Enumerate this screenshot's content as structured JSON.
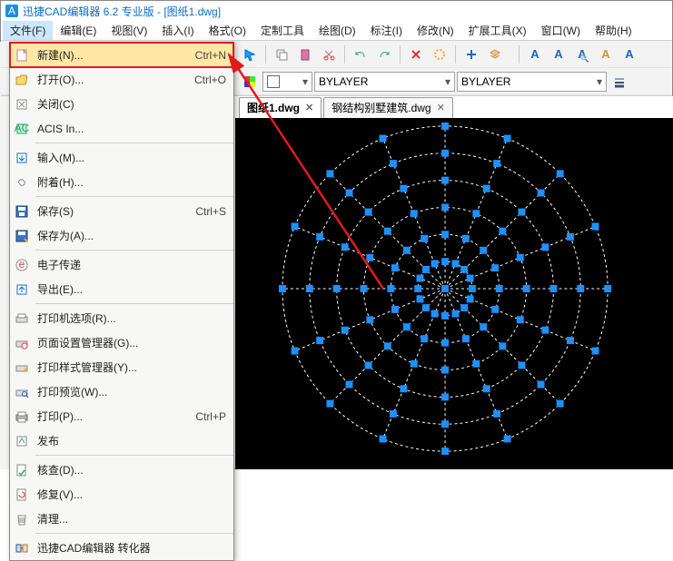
{
  "title": "迅捷CAD编辑器 6.2 专业版  -  [图纸1.dwg]",
  "menubar": [
    "文件(F)",
    "编辑(E)",
    "视图(V)",
    "插入(I)",
    "格式(O)",
    "定制工具",
    "绘图(D)",
    "标注(I)",
    "修改(N)",
    "扩展工具(X)",
    "窗口(W)",
    "帮助(H)"
  ],
  "layer_combo": "BYLAYER",
  "line_combo": "BYLAYER",
  "tabs": [
    {
      "label": "图纸1.dwg",
      "active": true
    },
    {
      "label": "钢结构别墅建筑.dwg",
      "active": false
    }
  ],
  "menu": [
    {
      "icon": "new",
      "label": "新建(N)...",
      "short": "Ctrl+N",
      "hi": true
    },
    {
      "icon": "open",
      "label": "打开(O)...",
      "short": "Ctrl+O"
    },
    {
      "icon": "close",
      "label": "关闭(C)"
    },
    {
      "icon": "acis",
      "label": "ACIS In..."
    },
    {
      "sep": true
    },
    {
      "icon": "import",
      "label": "输入(M)..."
    },
    {
      "icon": "attach",
      "label": "附着(H)..."
    },
    {
      "sep": true
    },
    {
      "icon": "save",
      "label": "保存(S)",
      "short": "Ctrl+S"
    },
    {
      "icon": "saveas",
      "label": "保存为(A)..."
    },
    {
      "sep": true
    },
    {
      "icon": "etrans",
      "label": "电子传递"
    },
    {
      "icon": "export",
      "label": "导出(E)..."
    },
    {
      "sep": true
    },
    {
      "icon": "popt",
      "label": "打印机选项(R)..."
    },
    {
      "icon": "psetup",
      "label": "页面设置管理器(G)..."
    },
    {
      "icon": "pstyle",
      "label": "打印样式管理器(Y)..."
    },
    {
      "icon": "ppreview",
      "label": "打印预览(W)..."
    },
    {
      "icon": "print",
      "label": "打印(P)...",
      "short": "Ctrl+P"
    },
    {
      "icon": "publish",
      "label": "发布"
    },
    {
      "sep": true
    },
    {
      "icon": "audit",
      "label": "核查(D)..."
    },
    {
      "icon": "recover",
      "label": "修复(V)..."
    },
    {
      "icon": "purge",
      "label": "清理..."
    },
    {
      "sep": true
    },
    {
      "icon": "conv",
      "label": "迅捷CAD编辑器 转化器"
    }
  ]
}
